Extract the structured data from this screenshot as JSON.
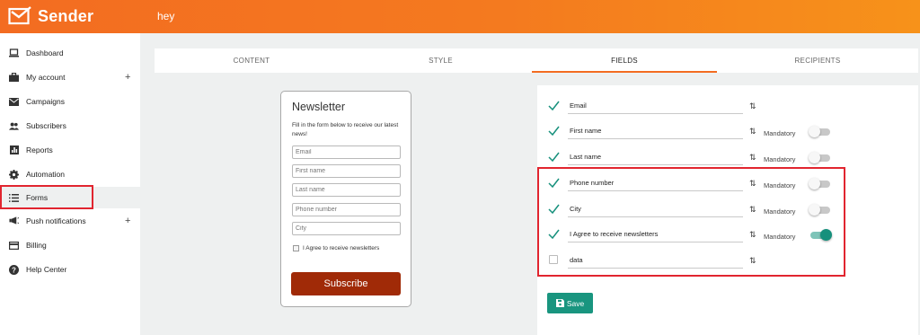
{
  "app": {
    "brand": "Sender",
    "page_heading": "hey",
    "accent": "#f36c21"
  },
  "sidebar": {
    "items": [
      {
        "label": "Dashboard",
        "icon": "laptop-icon"
      },
      {
        "label": "My account",
        "icon": "briefcase-icon",
        "plus": "+"
      },
      {
        "label": "Campaigns",
        "icon": "envelope-icon"
      },
      {
        "label": "Subscribers",
        "icon": "people-icon"
      },
      {
        "label": "Reports",
        "icon": "bar-chart-icon"
      },
      {
        "label": "Automation",
        "icon": "gear-icon"
      },
      {
        "label": "Forms",
        "icon": "list-icon"
      },
      {
        "label": "Push notifications",
        "icon": "megaphone-icon",
        "plus": "+"
      },
      {
        "label": "Billing",
        "icon": "credit-card-icon"
      },
      {
        "label": "Help Center",
        "icon": "help-icon"
      }
    ]
  },
  "tabs": [
    {
      "label": "CONTENT"
    },
    {
      "label": "STYLE"
    },
    {
      "label": "FIELDS",
      "active": true
    },
    {
      "label": "RECIPIENTS"
    }
  ],
  "preview": {
    "title": "Newsletter",
    "description": "Fill in the form below to receive our latest news!",
    "placeholders": [
      "Email",
      "First name",
      "Last name",
      "Phone number",
      "City"
    ],
    "agree_label": "I Agree to receive newsletters",
    "submit_label": "Subscribe"
  },
  "fields": {
    "mandatory_label": "Mandatory",
    "sort_glyph": "⇅",
    "rows": [
      {
        "name": "Email",
        "checked": true,
        "has_mandatory": false,
        "mandatory": false
      },
      {
        "name": "First name",
        "checked": true,
        "has_mandatory": true,
        "mandatory": false
      },
      {
        "name": "Last name",
        "checked": true,
        "has_mandatory": true,
        "mandatory": false
      },
      {
        "name": "Phone number",
        "checked": true,
        "has_mandatory": true,
        "mandatory": false
      },
      {
        "name": "City",
        "checked": true,
        "has_mandatory": true,
        "mandatory": false
      },
      {
        "name": "I Agree to receive newsletters",
        "checked": true,
        "has_mandatory": true,
        "mandatory": true
      },
      {
        "name": "data",
        "checked": false,
        "has_mandatory": false,
        "mandatory": false
      }
    ]
  },
  "save": {
    "label": "Save",
    "color": "#19957f"
  }
}
